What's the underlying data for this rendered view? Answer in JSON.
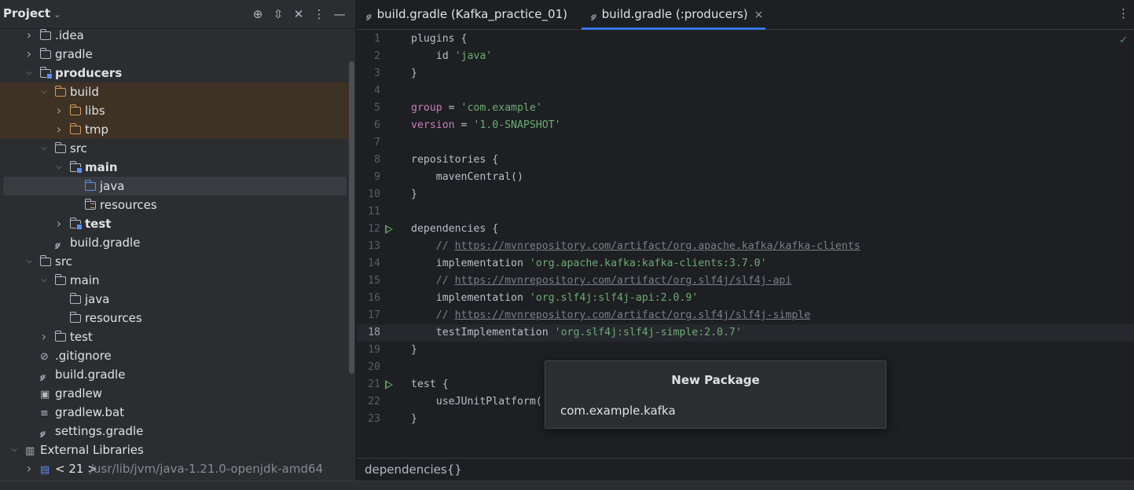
{
  "project_panel": {
    "title": "Project",
    "header_icons": [
      "locate-icon",
      "expand-collapse-icon",
      "collapse-all-icon",
      "more-options-icon",
      "hide-panel-icon"
    ]
  },
  "tree": [
    {
      "label": ".idea",
      "depth": 1,
      "arrow": "collapsed",
      "icon": "folder-icon",
      "bold": false
    },
    {
      "label": "gradle",
      "depth": 1,
      "arrow": "collapsed",
      "icon": "folder-icon",
      "bold": false
    },
    {
      "label": "producers",
      "depth": 1,
      "arrow": "expanded",
      "icon": "module-folder-icon",
      "bold": true
    },
    {
      "label": "build",
      "depth": 2,
      "arrow": "expanded",
      "icon": "excluded-folder-icon",
      "bold": false,
      "excluded": true
    },
    {
      "label": "libs",
      "depth": 3,
      "arrow": "collapsed",
      "icon": "excluded-folder-icon",
      "bold": false,
      "excluded": true
    },
    {
      "label": "tmp",
      "depth": 3,
      "arrow": "collapsed",
      "icon": "excluded-folder-icon",
      "bold": false,
      "excluded": true
    },
    {
      "label": "src",
      "depth": 2,
      "arrow": "expanded",
      "icon": "folder-icon",
      "bold": false
    },
    {
      "label": "main",
      "depth": 3,
      "arrow": "expanded",
      "icon": "module-folder-icon",
      "bold": true
    },
    {
      "label": "java",
      "depth": 4,
      "arrow": "none",
      "icon": "source-folder-icon",
      "bold": false,
      "selected": true
    },
    {
      "label": "resources",
      "depth": 4,
      "arrow": "none",
      "icon": "resources-folder-icon",
      "bold": false
    },
    {
      "label": "test",
      "depth": 3,
      "arrow": "collapsed",
      "icon": "module-folder-icon",
      "bold": true
    },
    {
      "label": "build.gradle",
      "depth": 2,
      "arrow": "none",
      "icon": "gradle-icon",
      "bold": false
    },
    {
      "label": "src",
      "depth": 1,
      "arrow": "expanded",
      "icon": "folder-icon",
      "bold": false
    },
    {
      "label": "main",
      "depth": 2,
      "arrow": "expanded",
      "icon": "folder-icon",
      "bold": false
    },
    {
      "label": "java",
      "depth": 3,
      "arrow": "none",
      "icon": "folder-icon",
      "bold": false
    },
    {
      "label": "resources",
      "depth": 3,
      "arrow": "none",
      "icon": "folder-icon",
      "bold": false
    },
    {
      "label": "test",
      "depth": 2,
      "arrow": "collapsed",
      "icon": "folder-icon",
      "bold": false
    },
    {
      "label": ".gitignore",
      "depth": 1,
      "arrow": "none",
      "icon": "ignore-file-icon",
      "bold": false
    },
    {
      "label": "build.gradle",
      "depth": 1,
      "arrow": "none",
      "icon": "gradle-icon",
      "bold": false
    },
    {
      "label": "gradlew",
      "depth": 1,
      "arrow": "none",
      "icon": "terminal-icon",
      "bold": false
    },
    {
      "label": "gradlew.bat",
      "depth": 1,
      "arrow": "none",
      "icon": "text-file-icon",
      "bold": false
    },
    {
      "label": "settings.gradle",
      "depth": 1,
      "arrow": "none",
      "icon": "gradle-icon",
      "bold": false
    },
    {
      "label": "External Libraries",
      "depth": 0,
      "arrow": "expanded",
      "icon": "library-icon",
      "bold": false
    },
    {
      "label": "< 21 >",
      "suffix": "/usr/lib/jvm/java-1.21.0-openjdk-amd64",
      "depth": 1,
      "arrow": "collapsed",
      "icon": "jdk-icon",
      "bold": false
    }
  ],
  "tabs": [
    {
      "label": "build.gradle (Kafka_practice_01)",
      "active": false,
      "closable": false
    },
    {
      "label": "build.gradle (:producers)",
      "active": true,
      "closable": true
    }
  ],
  "tab_close_glyph": "×",
  "code": [
    {
      "n": "1",
      "parts": [
        [
          "plain",
          "plugins {"
        ]
      ]
    },
    {
      "n": "2",
      "parts": [
        [
          "plain",
          "    id "
        ],
        [
          "str",
          "'java'"
        ]
      ]
    },
    {
      "n": "3",
      "parts": [
        [
          "plain",
          "}"
        ]
      ]
    },
    {
      "n": "4",
      "parts": []
    },
    {
      "n": "5",
      "parts": [
        [
          "kw",
          "group"
        ],
        [
          "plain",
          " = "
        ],
        [
          "str",
          "'com.example'"
        ]
      ]
    },
    {
      "n": "6",
      "parts": [
        [
          "kw",
          "version"
        ],
        [
          "plain",
          " = "
        ],
        [
          "str",
          "'1.0-SNAPSHOT'"
        ]
      ]
    },
    {
      "n": "7",
      "parts": []
    },
    {
      "n": "8",
      "parts": [
        [
          "plain",
          "repositories {"
        ]
      ]
    },
    {
      "n": "9",
      "parts": [
        [
          "plain",
          "    mavenCentral()"
        ]
      ]
    },
    {
      "n": "10",
      "parts": [
        [
          "plain",
          "}"
        ]
      ]
    },
    {
      "n": "11",
      "parts": []
    },
    {
      "n": "12",
      "parts": [
        [
          "plain",
          "dependencies {"
        ]
      ],
      "run": true
    },
    {
      "n": "13",
      "parts": [
        [
          "cm",
          "    // "
        ],
        [
          "url",
          "https://mvnrepository.com/artifact/org.apache.kafka/kafka-clients"
        ]
      ]
    },
    {
      "n": "14",
      "parts": [
        [
          "plain",
          "    implementation "
        ],
        [
          "str",
          "'org.apache.kafka:kafka-clients:3.7.0'"
        ]
      ]
    },
    {
      "n": "15",
      "parts": [
        [
          "cm",
          "    // "
        ],
        [
          "url",
          "https://mvnrepository.com/artifact/org.slf4j/slf4j-api"
        ]
      ]
    },
    {
      "n": "16",
      "parts": [
        [
          "plain",
          "    implementation "
        ],
        [
          "str",
          "'org.slf4j:slf4j-api:2.0.9'"
        ]
      ]
    },
    {
      "n": "17",
      "parts": [
        [
          "cm",
          "    // "
        ],
        [
          "url",
          "https://mvnrepository.com/artifact/org.slf4j/slf4j-simple"
        ]
      ]
    },
    {
      "n": "18",
      "parts": [
        [
          "plain",
          "    testImplementation "
        ],
        [
          "str",
          "'org.slf4j:slf4j-simple:2.0.7'"
        ]
      ],
      "current": true
    },
    {
      "n": "19",
      "parts": [
        [
          "plain",
          "}"
        ]
      ]
    },
    {
      "n": "20",
      "parts": []
    },
    {
      "n": "21",
      "parts": [
        [
          "plain",
          "test {"
        ]
      ],
      "run": true
    },
    {
      "n": "22",
      "parts": [
        [
          "plain",
          "    useJUnitPlatform("
        ]
      ]
    },
    {
      "n": "23",
      "parts": [
        [
          "plain",
          "}"
        ]
      ]
    }
  ],
  "breadcrumb": "dependencies{}",
  "popup": {
    "title": "New Package",
    "input_value": "com.example.kafka"
  },
  "colors": {
    "panel_bg": "#2b2d30",
    "editor_bg": "#1e1f22",
    "excluded_row": "#3d3223",
    "selected_row": "#393b40",
    "keyword": "#c77dbb",
    "string": "#6aab73",
    "comment": "#7a7e85",
    "run_gutter": "#57965c",
    "active_tab_underline": "#3574f0"
  }
}
